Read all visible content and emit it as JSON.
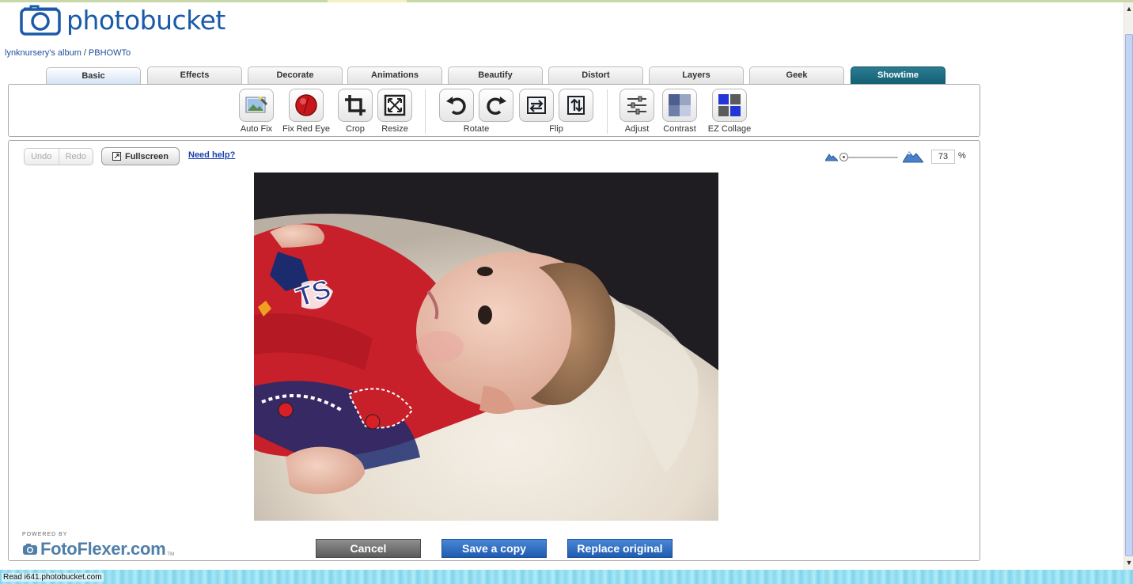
{
  "logo": {
    "text": "photobucket"
  },
  "breadcrumb": {
    "album": "lynknursery's album",
    "separator": "/",
    "folder": "PBHOWTo"
  },
  "tabs": [
    {
      "label": "Basic"
    },
    {
      "label": "Effects"
    },
    {
      "label": "Decorate"
    },
    {
      "label": "Animations"
    },
    {
      "label": "Beautify"
    },
    {
      "label": "Distort"
    },
    {
      "label": "Layers"
    },
    {
      "label": "Geek"
    },
    {
      "label": "Showtime"
    }
  ],
  "toolbar": {
    "auto_fix": "Auto Fix",
    "fix_red_eye": "Fix Red Eye",
    "crop": "Crop",
    "resize": "Resize",
    "rotate": "Rotate",
    "flip": "Flip",
    "adjust": "Adjust",
    "contrast": "Contrast",
    "ez_collage": "EZ Collage"
  },
  "editor": {
    "undo": "Undo",
    "redo": "Redo",
    "fullscreen": "Fullscreen",
    "help": "Need help?",
    "zoom_value": "73",
    "zoom_unit": "%"
  },
  "footer": {
    "powered_by": "POWERED BY",
    "brand": "FotoFlexer.com",
    "tm": "TM",
    "cancel": "Cancel",
    "save_copy": "Save a copy",
    "replace": "Replace original"
  },
  "status": {
    "text": "Read i641.photobucket.com"
  },
  "colors": {
    "brand_blue": "#1a5aa8",
    "showtime_tab": "#135f73",
    "action_blue": "#1f5cb0"
  }
}
